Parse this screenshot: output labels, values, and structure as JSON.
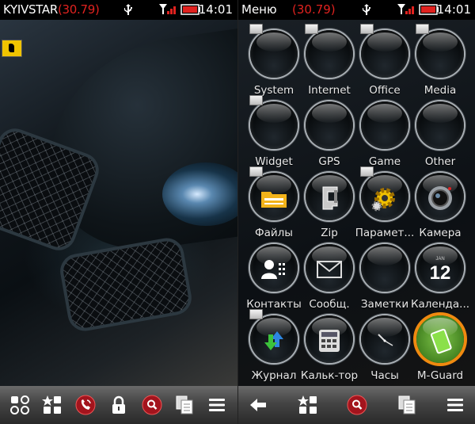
{
  "left_screen": {
    "status_bar": {
      "operator": "KYIVSTAR",
      "balance": "(30.79)",
      "time": "14:01"
    },
    "toolbar": [
      "apps-grid-icon",
      "favorites-icon",
      "phone-icon",
      "lock-icon",
      "search-icon",
      "copy-icon",
      "menu-icon"
    ]
  },
  "right_screen": {
    "status_bar": {
      "title": "Меню",
      "balance": "(30.79)",
      "time": "14:01"
    },
    "menu_items": [
      {
        "label": "System",
        "icon": "folder-icon"
      },
      {
        "label": "Internet",
        "icon": "folder-icon"
      },
      {
        "label": "Office",
        "icon": "folder-icon"
      },
      {
        "label": "Media",
        "icon": "folder-icon"
      },
      {
        "label": "Widget",
        "icon": "folder-icon"
      },
      {
        "label": "GPS",
        "icon": "folder-icon"
      },
      {
        "label": "Game",
        "icon": "folder-icon"
      },
      {
        "label": "Other",
        "icon": "folder-icon"
      },
      {
        "label": "Файлы",
        "icon": "files-icon"
      },
      {
        "label": "Zip",
        "icon": "zip-clamp-icon"
      },
      {
        "label": "Парамет...",
        "icon": "settings-gears-icon"
      },
      {
        "label": "Камера",
        "icon": "camera-icon"
      },
      {
        "label": "Контакты",
        "icon": "contacts-icon"
      },
      {
        "label": "Сообщ.",
        "icon": "messages-icon"
      },
      {
        "label": "Заметки",
        "icon": "notes-icon"
      },
      {
        "label": "Календа...",
        "icon": "calendar-icon",
        "calendar_month": "JAN",
        "calendar_day": "12"
      },
      {
        "label": "Журнал",
        "icon": "log-icon"
      },
      {
        "label": "Кальк-тор",
        "icon": "calculator-icon"
      },
      {
        "label": "Часы",
        "icon": "clock-icon"
      },
      {
        "label": "M-Guard",
        "icon": "battery-icon"
      }
    ],
    "toolbar": [
      "back-arrow-icon",
      "favorites-icon",
      "search-icon",
      "copy-icon",
      "menu-icon"
    ]
  },
  "colors": {
    "balance_red": "#e0221f",
    "search_red": "#a3141d",
    "calendar_orange": "#f08a10"
  }
}
